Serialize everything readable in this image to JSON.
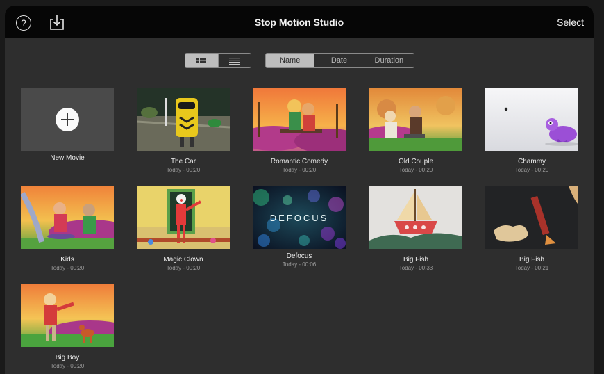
{
  "header": {
    "title": "Stop Motion Studio",
    "select_label": "Select",
    "help_glyph": "?",
    "help_icon": "question-circle-icon",
    "import_icon": "download-tray-icon"
  },
  "toolbar": {
    "view_modes": [
      "grid-icon",
      "list-icon"
    ],
    "active_view": "grid",
    "sort_options": [
      "Name",
      "Date",
      "Duration"
    ],
    "active_sort": "Name"
  },
  "new_movie": {
    "label": "New Movie",
    "icon": "plus-circle-icon"
  },
  "movies": [
    {
      "title": "The Car",
      "meta": "Today - 00:20"
    },
    {
      "title": "Romantic Comedy",
      "meta": "Today - 00:20"
    },
    {
      "title": "Old Couple",
      "meta": "Today - 00:20"
    },
    {
      "title": "Chammy",
      "meta": "Today - 00:20"
    },
    {
      "title": "Kids",
      "meta": "Today - 00:20"
    },
    {
      "title": "Magic Clown",
      "meta": "Today - 00:20"
    },
    {
      "title": "Defocus",
      "meta": "Today - 00:06",
      "overlay_text": "DEFOCUS"
    },
    {
      "title": "Big Fish",
      "meta": "Today - 00:33"
    },
    {
      "title": "Big Fish",
      "meta": "Today - 00:21"
    },
    {
      "title": "Big Boy",
      "meta": "Today - 00:20"
    }
  ],
  "colors": {
    "background": "#2e2e2e",
    "header": "#060606",
    "segment_active": "#bdbdbd"
  }
}
